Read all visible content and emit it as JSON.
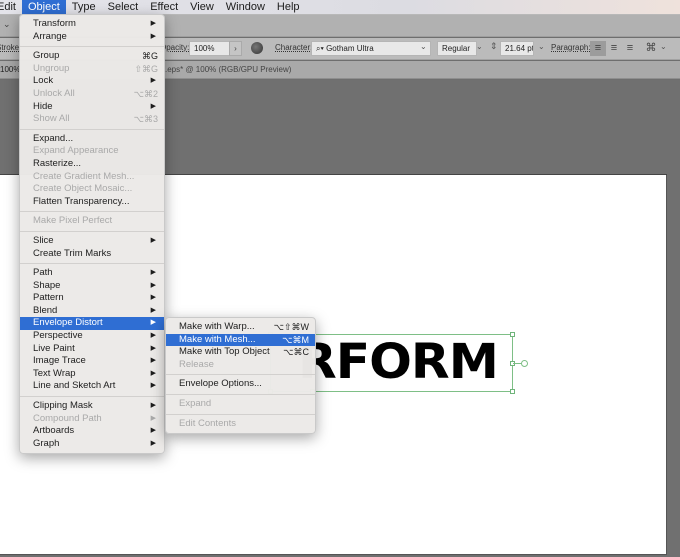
{
  "menubar": {
    "items": [
      {
        "label": "Edit",
        "active": false
      },
      {
        "label": "Object",
        "active": true
      },
      {
        "label": "Type",
        "active": false
      },
      {
        "label": "Select",
        "active": false
      },
      {
        "label": "Effect",
        "active": false
      },
      {
        "label": "View",
        "active": false
      },
      {
        "label": "Window",
        "active": false
      },
      {
        "label": "Help",
        "active": false
      }
    ]
  },
  "control_bar": {
    "stroke_label": "Stroke:",
    "opacity_label": "Opacity:",
    "opacity_value": "100%",
    "character_label": "Character:",
    "font_family": "Gotham Ultra",
    "font_style": "Regular",
    "font_size": "21.64 pt",
    "paragraph_label": "Paragraph:"
  },
  "tabbar": {
    "zoom_left": "100%",
    "doc_title": ".eps* @ 100% (RGB/GPU Preview)"
  },
  "artboard": {
    "text": "RFORM"
  },
  "object_menu": {
    "groups": [
      [
        {
          "label": "Transform",
          "submenu": true,
          "disabled": false
        },
        {
          "label": "Arrange",
          "submenu": true,
          "disabled": false
        }
      ],
      [
        {
          "label": "Group",
          "shortcut": "⌘G",
          "disabled": false
        },
        {
          "label": "Ungroup",
          "shortcut": "⇧⌘G",
          "disabled": true
        },
        {
          "label": "Lock",
          "submenu": true,
          "disabled": false
        },
        {
          "label": "Unlock All",
          "shortcut": "⌥⌘2",
          "disabled": true
        },
        {
          "label": "Hide",
          "submenu": true,
          "disabled": false
        },
        {
          "label": "Show All",
          "shortcut": "⌥⌘3",
          "disabled": true
        }
      ],
      [
        {
          "label": "Expand...",
          "disabled": false
        },
        {
          "label": "Expand Appearance",
          "disabled": true
        },
        {
          "label": "Rasterize...",
          "disabled": false
        },
        {
          "label": "Create Gradient Mesh...",
          "disabled": true
        },
        {
          "label": "Create Object Mosaic...",
          "disabled": true
        },
        {
          "label": "Flatten Transparency...",
          "disabled": false
        }
      ],
      [
        {
          "label": "Make Pixel Perfect",
          "disabled": true
        }
      ],
      [
        {
          "label": "Slice",
          "submenu": true,
          "disabled": false
        },
        {
          "label": "Create Trim Marks",
          "disabled": false
        }
      ],
      [
        {
          "label": "Path",
          "submenu": true,
          "disabled": false
        },
        {
          "label": "Shape",
          "submenu": true,
          "disabled": false
        },
        {
          "label": "Pattern",
          "submenu": true,
          "disabled": false
        },
        {
          "label": "Blend",
          "submenu": true,
          "disabled": false
        },
        {
          "label": "Envelope Distort",
          "submenu": true,
          "disabled": false,
          "highlighted": true
        },
        {
          "label": "Perspective",
          "submenu": true,
          "disabled": false
        },
        {
          "label": "Live Paint",
          "submenu": true,
          "disabled": false
        },
        {
          "label": "Image Trace",
          "submenu": true,
          "disabled": false
        },
        {
          "label": "Text Wrap",
          "submenu": true,
          "disabled": false
        },
        {
          "label": "Line and Sketch Art",
          "submenu": true,
          "disabled": false
        }
      ],
      [
        {
          "label": "Clipping Mask",
          "submenu": true,
          "disabled": false
        },
        {
          "label": "Compound Path",
          "submenu": true,
          "disabled": true
        },
        {
          "label": "Artboards",
          "submenu": true,
          "disabled": false
        },
        {
          "label": "Graph",
          "submenu": true,
          "disabled": false
        }
      ]
    ]
  },
  "envelope_submenu": {
    "groups": [
      [
        {
          "label": "Make with Warp...",
          "shortcut": "⌥⇧⌘W",
          "disabled": false
        },
        {
          "label": "Make with Mesh...",
          "shortcut": "⌥⌘M",
          "disabled": false,
          "highlighted": true
        },
        {
          "label": "Make with Top Object",
          "shortcut": "⌥⌘C",
          "disabled": false
        },
        {
          "label": "Release",
          "disabled": true
        }
      ],
      [
        {
          "label": "Envelope Options...",
          "disabled": false
        }
      ],
      [
        {
          "label": "Expand",
          "disabled": true
        }
      ],
      [
        {
          "label": "Edit Contents",
          "disabled": true
        }
      ]
    ]
  },
  "colors": {
    "highlight": "#2f6ed3",
    "selection_bbox": "#7ebf86"
  }
}
